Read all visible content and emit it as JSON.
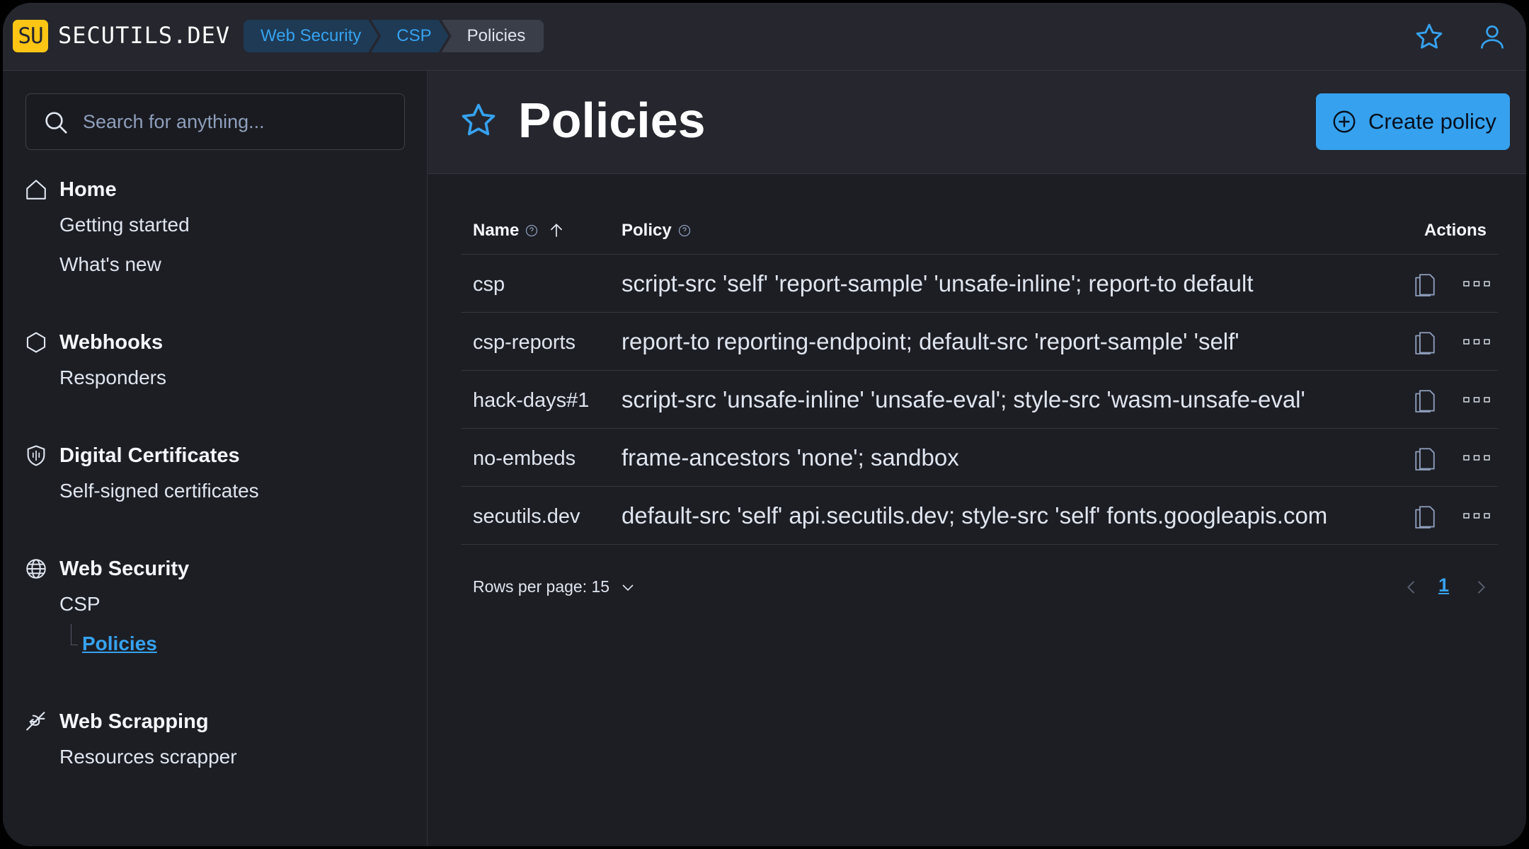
{
  "header": {
    "logo_badge": "SU",
    "logo_text": "SECUTILS.DEV",
    "breadcrumbs": [
      "Web Security",
      "CSP",
      "Policies"
    ],
    "icons": [
      "star-icon",
      "user-icon"
    ]
  },
  "sidebar": {
    "search_placeholder": "Search for anything...",
    "groups": [
      {
        "label": "Home",
        "icon": "home-icon",
        "items": [
          "Getting started",
          "What's new"
        ]
      },
      {
        "label": "Webhooks",
        "icon": "hexagon-icon",
        "items": [
          "Responders"
        ]
      },
      {
        "label": "Digital Certificates",
        "icon": "shield-icon",
        "items": [
          "Self-signed certificates"
        ]
      },
      {
        "label": "Web Security",
        "icon": "globe-icon",
        "items": [
          "CSP"
        ],
        "subitems": [
          "Policies"
        ]
      },
      {
        "label": "Web Scrapping",
        "icon": "scrapper-icon",
        "items": [
          "Resources scrapper"
        ]
      }
    ]
  },
  "main": {
    "title": "Policies",
    "create_button": "Create policy",
    "table": {
      "columns": [
        "Name",
        "Policy",
        "Actions"
      ],
      "rows": [
        {
          "name": "csp",
          "policy": "script-src 'self' 'report-sample' 'unsafe-inline'; report-to default"
        },
        {
          "name": "csp-reports",
          "policy": "report-to reporting-endpoint; default-src 'report-sample' 'self'"
        },
        {
          "name": "hack-days#1",
          "policy": "script-src 'unsafe-inline' 'unsafe-eval'; style-src 'wasm-unsafe-eval'"
        },
        {
          "name": "no-embeds",
          "policy": "frame-ancestors 'none'; sandbox"
        },
        {
          "name": "secutils.dev",
          "policy": "default-src 'self' api.secutils.dev; style-src 'self' fonts.googleapis.com"
        }
      ]
    },
    "pagination": {
      "rows_per_page_label": "Rows per page: 15",
      "current_page": "1"
    }
  },
  "colors": {
    "accent": "#36a2ef",
    "brand": "#fec514",
    "background": "#1d1e24",
    "panel": "#25262e"
  }
}
